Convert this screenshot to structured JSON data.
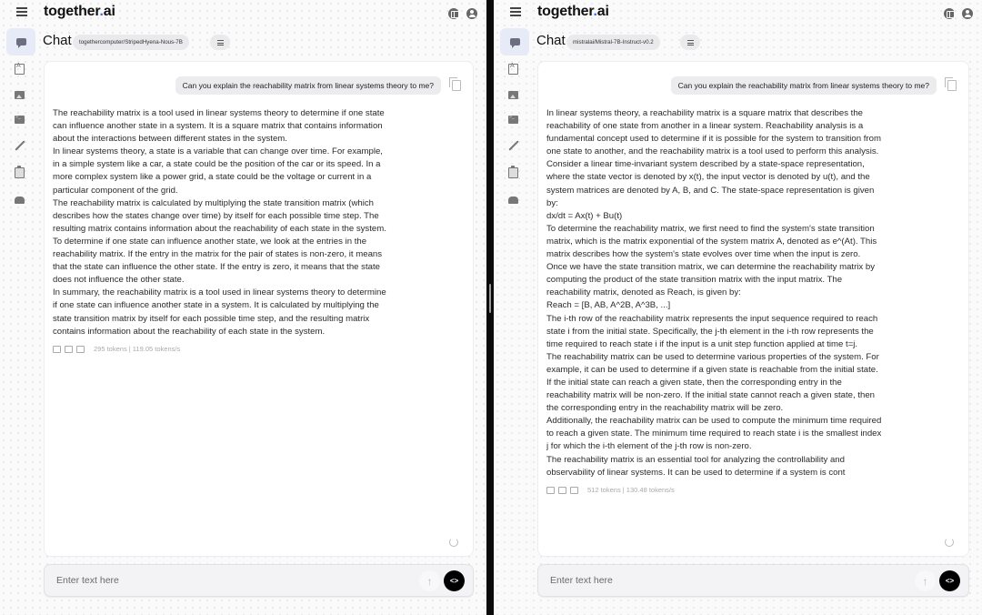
{
  "app": {
    "brand_name": "together",
    "brand_dot": ".",
    "brand_suffix": "ai",
    "accent_color": "#2f6bff",
    "top_icons": [
      "book-icon",
      "user-account-icon"
    ],
    "sidebar_icons": [
      "chat-icon",
      "book-icon",
      "image-icon",
      "terminal-icon",
      "brush-icon",
      "clipboard-icon",
      "car-icon"
    ]
  },
  "panes": [
    {
      "page_title": "Chat",
      "model": "togethercomputer/StripedHyena-Nous-7B",
      "user_message": "Can you explain the reachability matrix from linear systems theory to me?",
      "answer_paragraphs": [
        "The reachability matrix is a tool used in linear systems theory to determine if one state can influence another state in a system. It is a square matrix that contains information about the interactions between different states in the system.",
        "In linear systems theory, a state is a variable that can change over time. For example, in a simple system like a car, a state could be the position of the car or its speed. In a more complex system like a power grid, a state could be the voltage or current in a particular component of the grid.",
        "The reachability matrix is calculated by multiplying the state transition matrix (which describes how the states change over time) by itself for each possible time step. The resulting matrix contains information about the reachability of each state in the system.",
        "To determine if one state can influence another state, we look at the entries in the reachability matrix. If the entry in the matrix for the pair of states is non-zero, it means that the state can influence the other state. If the entry is zero, it means that the state does not influence the other state.",
        "In summary, the reachability matrix is a tool used in linear systems theory to determine if one state can influence another state in a system. It is calculated by multiplying the state transition matrix by itself for each possible time step, and the resulting matrix contains information about the reachability of each state in the system."
      ],
      "stats": "295 tokens | 119.05 tokens/s",
      "input_placeholder": "Enter text here",
      "input_value": ""
    },
    {
      "page_title": "Chat",
      "model": "mistralai/Mistral-7B-Instruct-v0.2",
      "user_message": "Can you explain the reachability matrix from linear systems theory to me?",
      "answer_paragraphs": [
        "In linear systems theory, a reachability matrix is a square matrix that describes the reachability of one state from another in a linear system. Reachability analysis is a fundamental concept used to determine if it is possible for the system to transition from one state to another, and the reachability matrix is a tool used to perform this analysis.",
        "Consider a linear time-invariant system described by a state-space representation, where the state vector is denoted by x(t), the input vector is denoted by u(t), and the system matrices are denoted by A, B, and C. The state-space representation is given by:",
        "dx/dt = Ax(t) + Bu(t)",
        "To determine the reachability matrix, we first need to find the system's state transition matrix, which is the matrix exponential of the system matrix A, denoted as e^(At). This matrix describes how the system's state evolves over time when the input is zero.",
        "Once we have the state transition matrix, we can determine the reachability matrix by computing the product of the state transition matrix with the input matrix. The reachability matrix, denoted as Reach, is given by:",
        "Reach = [B, AB, A^2B, A^3B, ...]",
        "The i-th row of the reachability matrix represents the input sequence required to reach state i from the initial state. Specifically, the j-th element in the i-th row represents the time required to reach state i if the input is a unit step function applied at time t=j.",
        "The reachability matrix can be used to determine various properties of the system. For example, it can be used to determine if a given state is reachable from the initial state. If the initial state can reach a given state, then the corresponding entry in the reachability matrix will be non-zero. If the initial state cannot reach a given state, then the corresponding entry in the reachability matrix will be zero.",
        "Additionally, the reachability matrix can be used to compute the minimum time required to reach a given state. The minimum time required to reach state i is the smallest index j for which the i-th element of the j-th row is non-zero.",
        "The reachability matrix is an essential tool for analyzing the controllability and observability of linear systems. It can be used to determine if a system is cont"
      ],
      "stats": "512 tokens | 130.48 tokens/s",
      "input_placeholder": "Enter text here",
      "input_value": ""
    }
  ],
  "send_button_glyph": "<>",
  "upload_button_glyph": "↑"
}
